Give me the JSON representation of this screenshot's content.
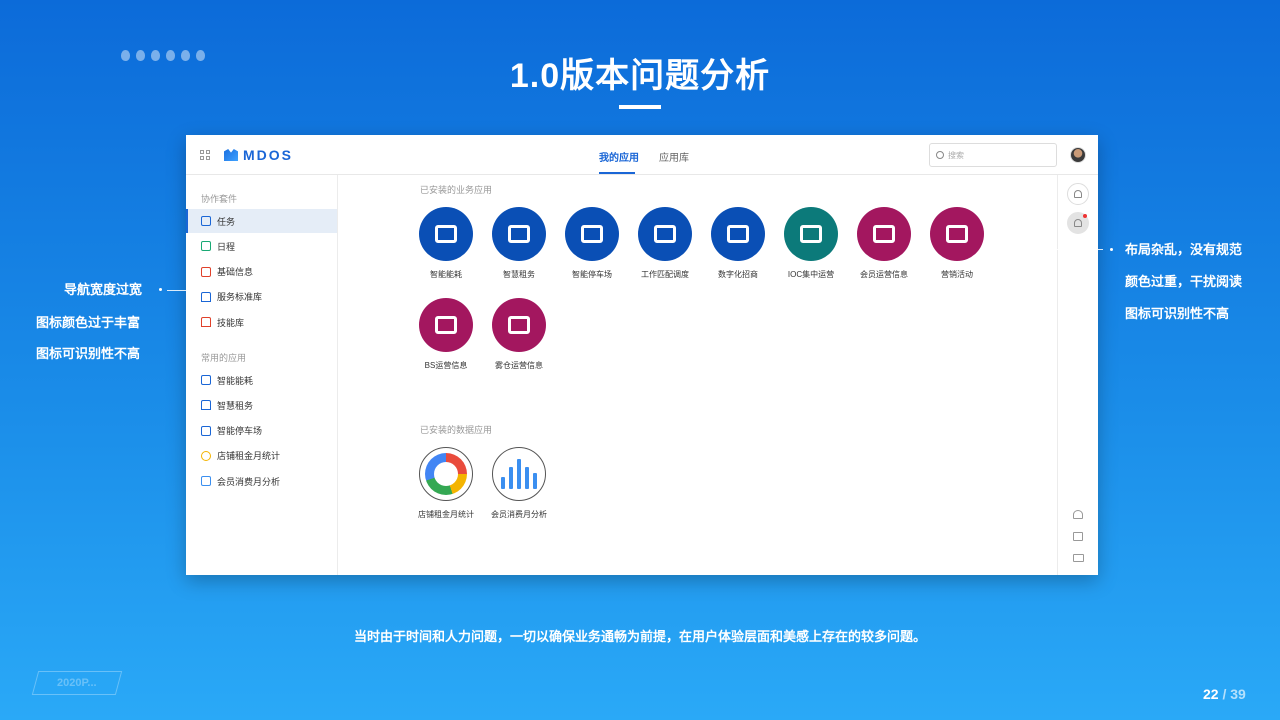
{
  "slide": {
    "title": "1.0版本问题分析",
    "footer": "当时由于时间和人力问题，一切以确保业务通畅为前提，在用户体验层面和美感上存在的较多问题。",
    "badge": "2020P...",
    "page_current": "22",
    "page_sep": " / ",
    "page_total": "39"
  },
  "annotations": {
    "left": [
      "导航宽度过宽",
      "图标颜色过于丰富",
      "图标可识别性不高"
    ],
    "right": [
      "布局杂乱，没有规范",
      "颜色过重，干扰阅读",
      "图标可识别性不高"
    ]
  },
  "app": {
    "logo_text": "MDOS",
    "tabs": [
      "我的应用",
      "应用库"
    ],
    "search_placeholder": "搜索",
    "sidebar": {
      "group1": "协作套件",
      "group1_items": [
        {
          "label": "任务",
          "icon": "pin-icon",
          "color": "#1a66d6"
        },
        {
          "label": "日程",
          "icon": "calendar-icon",
          "color": "#19a974"
        },
        {
          "label": "基础信息",
          "icon": "info-icon",
          "color": "#e0412b"
        },
        {
          "label": "服务标准库",
          "icon": "home-icon",
          "color": "#1a66d6"
        },
        {
          "label": "技能库",
          "icon": "skill-icon",
          "color": "#e0412b"
        }
      ],
      "group2": "常用的应用",
      "group2_items": [
        {
          "label": "智能能耗",
          "icon": "printer-icon",
          "color": "#1a66d6"
        },
        {
          "label": "智慧租务",
          "icon": "home-icon",
          "color": "#1a66d6"
        },
        {
          "label": "智能停车场",
          "icon": "truck-icon",
          "color": "#1a66d6"
        },
        {
          "label": "店铺租金月统计",
          "icon": "donut-icon",
          "color": "#f4b400"
        },
        {
          "label": "会员消费月分析",
          "icon": "bars-icon",
          "color": "#3b8ff0"
        }
      ]
    },
    "installed_business_title": "已安装的业务应用",
    "business_apps": [
      {
        "label": "智能能耗",
        "color": "#0a4fb5",
        "icon": "printer-icon"
      },
      {
        "label": "智慧租务",
        "color": "#0a4fb5",
        "icon": "home-icon"
      },
      {
        "label": "智能停车场",
        "color": "#0a4fb5",
        "icon": "truck-icon"
      },
      {
        "label": "工作匹配调度",
        "color": "#0a4fb5",
        "icon": "people-icon"
      },
      {
        "label": "数字化招商",
        "color": "#0a4fb5",
        "icon": "handshake-icon"
      },
      {
        "label": "IOC集中运营",
        "color": "#0c7a7a",
        "icon": "monitor-icon"
      },
      {
        "label": "会员运营信息",
        "color": "#a3175f",
        "icon": "members-icon"
      },
      {
        "label": "营销活动",
        "color": "#a3175f",
        "icon": "chart-line-icon"
      },
      {
        "label": "BS运营信息",
        "color": "#a3175f",
        "icon": "bar-chart-icon"
      },
      {
        "label": "雾仓运营信息",
        "color": "#a3175f",
        "icon": "house-chart-icon"
      }
    ],
    "installed_data_title": "已安装的数据应用",
    "data_apps": [
      {
        "label": "店铺租金月统计",
        "icon": "donut-icon"
      },
      {
        "label": "会员消费月分析",
        "icon": "bars-icon"
      }
    ],
    "accent": "#1a66d6"
  }
}
